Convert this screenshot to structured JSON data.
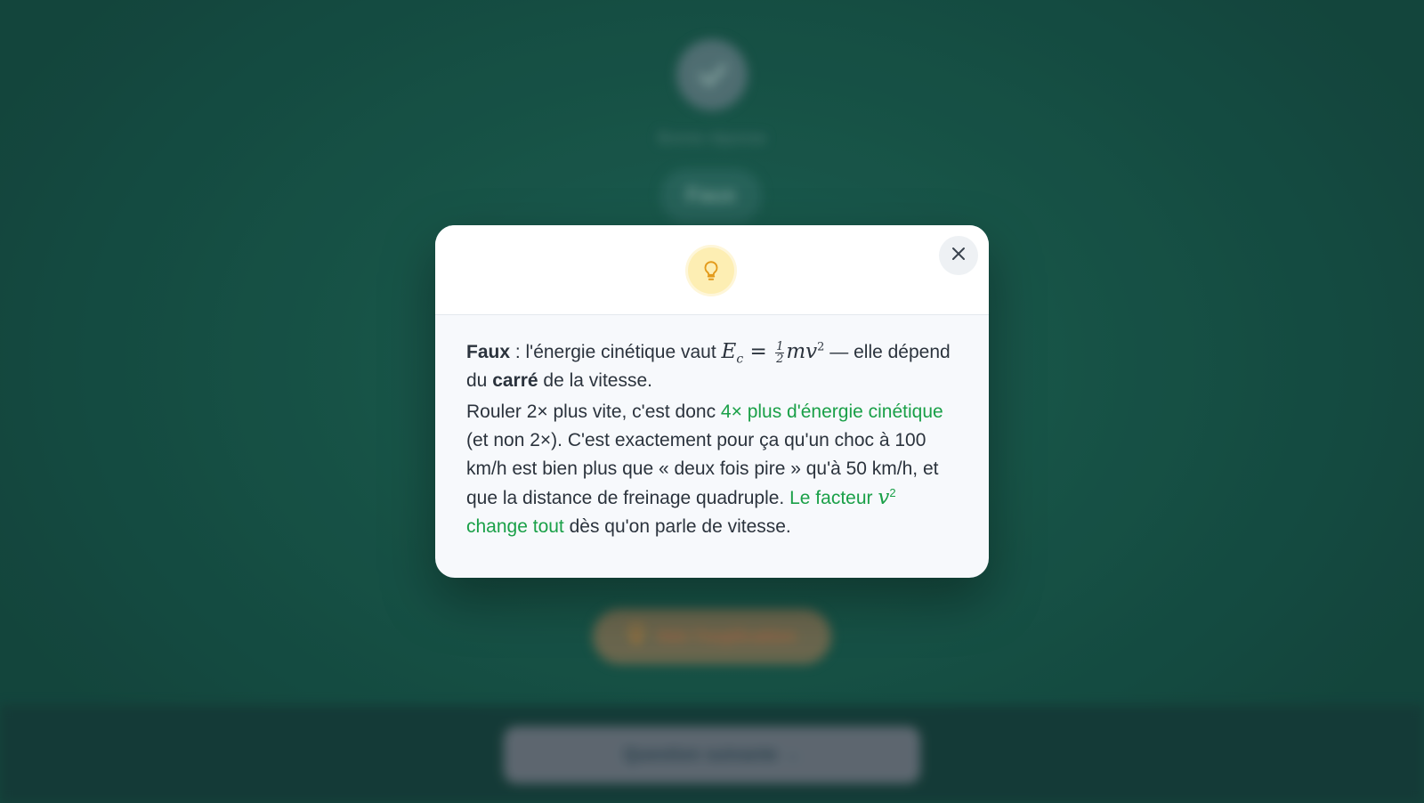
{
  "background": {
    "answer_label": "Bonne réponse",
    "verdict_pill": "Faux",
    "explain_button_label": "Voir l'explication",
    "next_button_label": "Question suivante →"
  },
  "modal": {
    "icon": "lightbulb-icon",
    "close_icon": "close-icon",
    "para1": {
      "lead_bold": "Faux",
      "t1": " : l'énergie cinétique vaut ",
      "formula_E": "E",
      "formula_sub": "c",
      "formula_eq": " = ",
      "frac_num": "1",
      "frac_den": "2",
      "formula_mv": "mv",
      "formula_exp": "2",
      "t2": " — elle dépend du ",
      "bold_word": "carré",
      "t3": " de la vitesse."
    },
    "para2": {
      "t1": "Rouler 2× plus vite, c'est donc ",
      "green1": "4× plus d'énergie cinétique",
      "t2": " (et non 2×). C'est exactement pour ça qu'un choc à 100 km/h est bien plus que « deux fois pire » qu'à 50 km/h, et que la distance de freinage quadruple. ",
      "green2_a": "Le facteur ",
      "green2_var": "v",
      "green2_exp": "2",
      "green2_b": " change tout",
      "t3": " dès qu'on parle de vitesse."
    }
  },
  "colors": {
    "accent_green": "#1aa048",
    "bulb_bg": "#fdeeb3",
    "bulb_stroke": "#e39a1a",
    "backdrop": "#1b5a4d"
  }
}
